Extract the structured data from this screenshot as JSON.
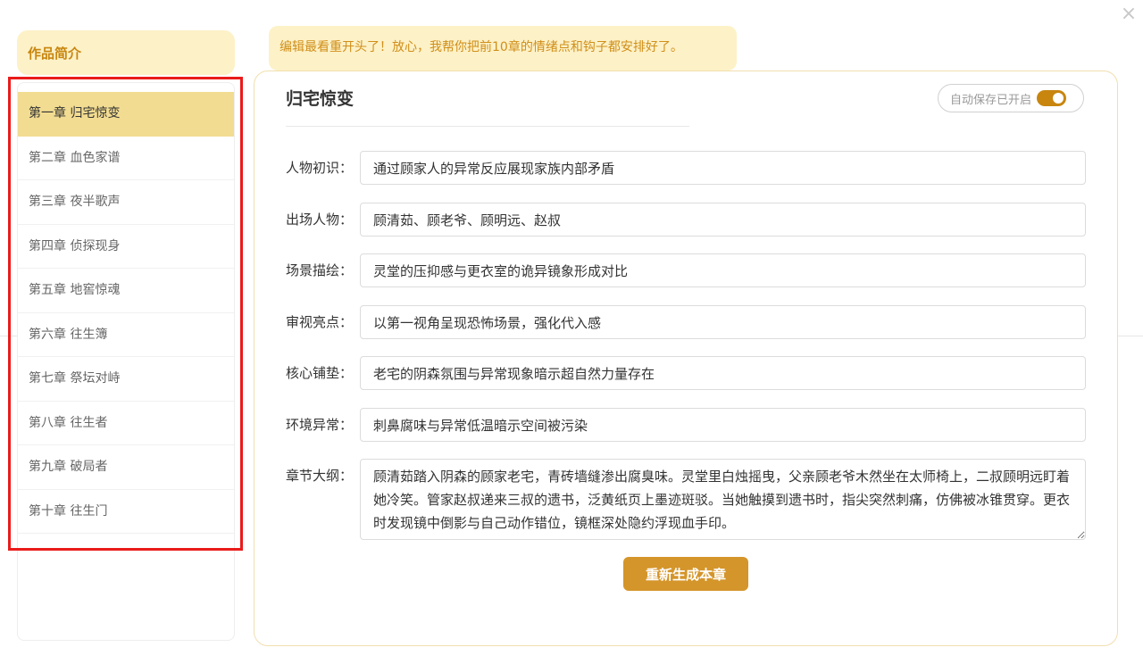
{
  "close_icon": "×",
  "intro_tab": {
    "label": "作品简介"
  },
  "chapters": [
    {
      "label": "第一章 归宅惊变",
      "active": true
    },
    {
      "label": "第二章 血色家谱"
    },
    {
      "label": "第三章 夜半歌声"
    },
    {
      "label": "第四章 侦探现身"
    },
    {
      "label": "第五章 地窖惊魂"
    },
    {
      "label": "第六章 往生簿"
    },
    {
      "label": "第七章 祭坛对峙"
    },
    {
      "label": "第八章 往生者"
    },
    {
      "label": "第九章 破局者"
    },
    {
      "label": "第十章 往生门"
    }
  ],
  "notice": {
    "text": "编辑最看重开头了！放心，我帮你把前10章的情绪点和钩子都安排好了。"
  },
  "editor": {
    "title": "归宅惊变",
    "autosave_label": "自动保存已开启",
    "autosave_on": true,
    "fields": [
      {
        "label": "人物初识：",
        "value": "通过顾家人的异常反应展现家族内部矛盾"
      },
      {
        "label": "出场人物：",
        "value": "顾清茹、顾老爷、顾明远、赵叔"
      },
      {
        "label": "场景描绘：",
        "value": "灵堂的压抑感与更衣室的诡异镜象形成对比"
      },
      {
        "label": "审视亮点：",
        "value": "以第一视角呈现恐怖场景，强化代入感"
      },
      {
        "label": "核心铺垫：",
        "value": "老宅的阴森氛围与异常现象暗示超自然力量存在"
      },
      {
        "label": "环境异常：",
        "value": "刺鼻腐味与异常低温暗示空间被污染"
      }
    ],
    "outline": {
      "label": "章节大纲：",
      "value": "顾清茹踏入阴森的顾家老宅，青砖墙缝渗出腐臭味。灵堂里白烛摇曳，父亲顾老爷木然坐在太师椅上，二叔顾明远盯着她冷笑。管家赵叔递来三叔的遗书，泛黄纸页上墨迹斑驳。当她触摸到遗书时，指尖突然刺痛，仿佛被冰锥贯穿。更衣时发现镜中倒影与自己动作错位，镜框深处隐约浮现血手印。"
    },
    "regenerate_label": "重新生成本章"
  },
  "colors": {
    "accent": "#d4952a",
    "accent_light": "#fdf1c7",
    "active_chapter": "#f2dc91",
    "highlight_border": "#ea1b1b"
  }
}
